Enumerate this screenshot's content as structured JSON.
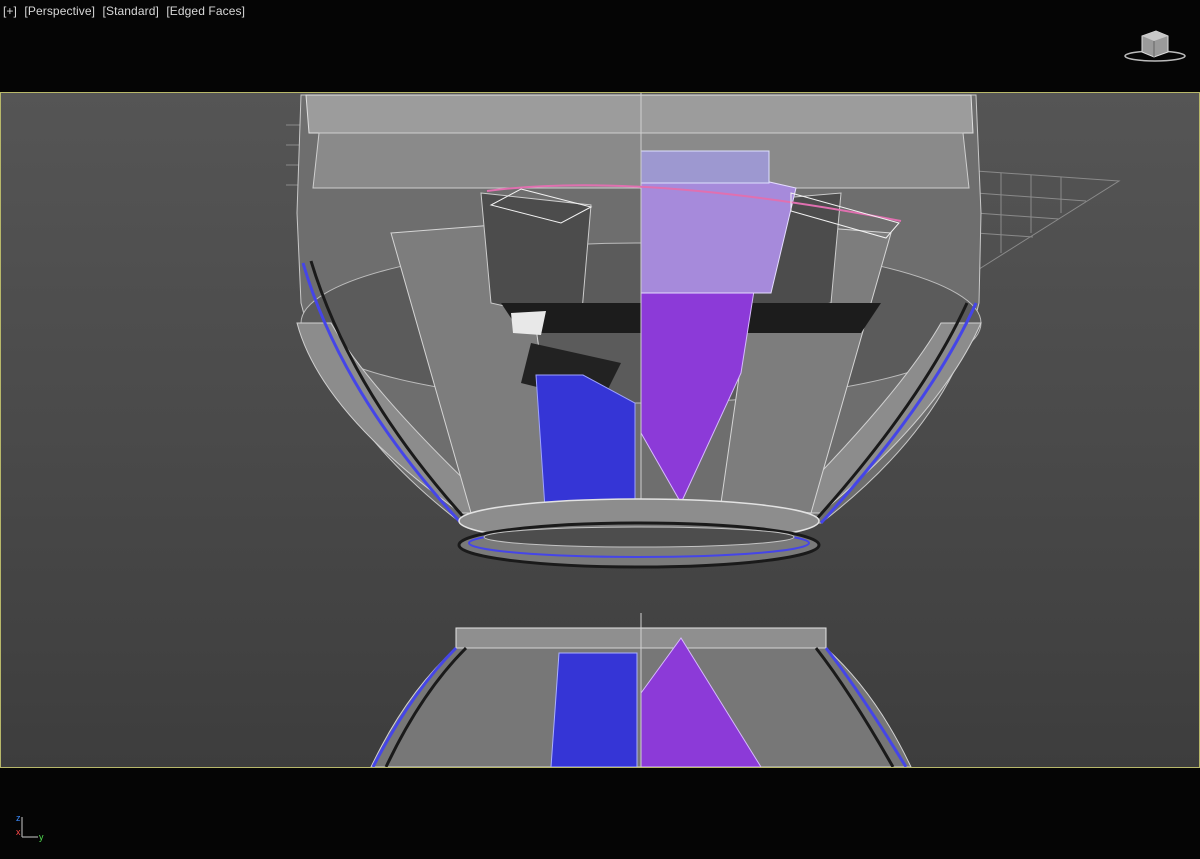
{
  "viewport": {
    "menu_label": "[+]",
    "view_label": "[Perspective]",
    "shading_label": "[Standard]",
    "edge_label": "[Edged Faces]"
  },
  "axis": {
    "x": "x",
    "y": "y",
    "z": "z"
  },
  "colors": {
    "frame_border": "#b8b86a",
    "selected_blue": "#3535d6",
    "selected_purple": "#8c3ad8",
    "mesh_gray": "#7a7a7a"
  },
  "icons": {
    "viewcube": "viewcube-icon"
  }
}
